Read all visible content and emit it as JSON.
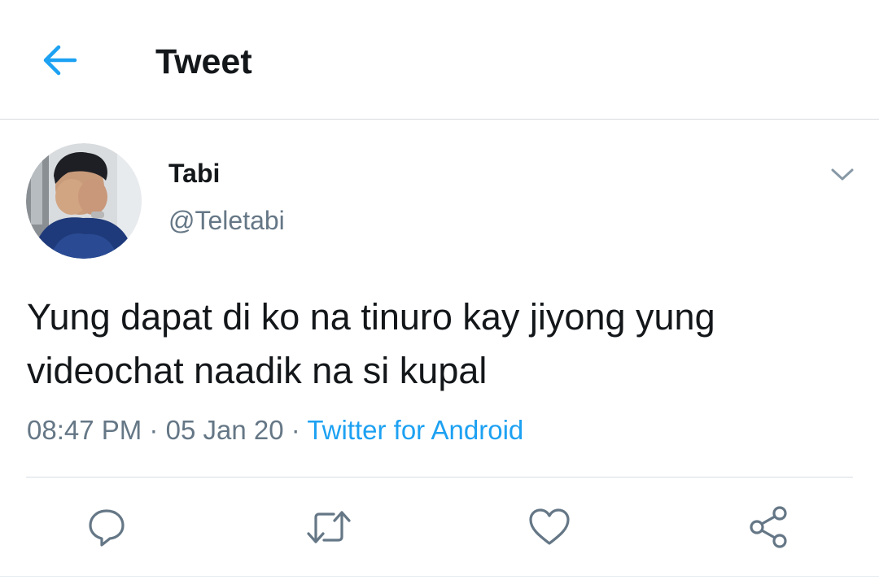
{
  "header": {
    "title": "Tweet",
    "back_icon": "arrow-left-icon",
    "accent_color": "#1da1f2"
  },
  "tweet": {
    "author_name": "Tabi",
    "author_handle": "@Teletabi",
    "avatar": "avatar-photo",
    "menu_icon": "chevron-down-icon",
    "text_line1": "Yung dapat di ko na tinuro kay jiyong yung",
    "text_line2": "videochat naadik na si kupal",
    "time": "08:47 PM",
    "date": "05 Jan 20",
    "separator": "·",
    "source": "Twitter for Android"
  },
  "actions": [
    {
      "name": "reply",
      "icon": "reply-icon"
    },
    {
      "name": "retweet",
      "icon": "retweet-icon"
    },
    {
      "name": "like",
      "icon": "heart-icon"
    },
    {
      "name": "share",
      "icon": "share-icon"
    }
  ],
  "colors": {
    "text_primary": "#14171a",
    "text_secondary": "#657786",
    "link": "#1da1f2",
    "divider": "#d8dde1"
  }
}
